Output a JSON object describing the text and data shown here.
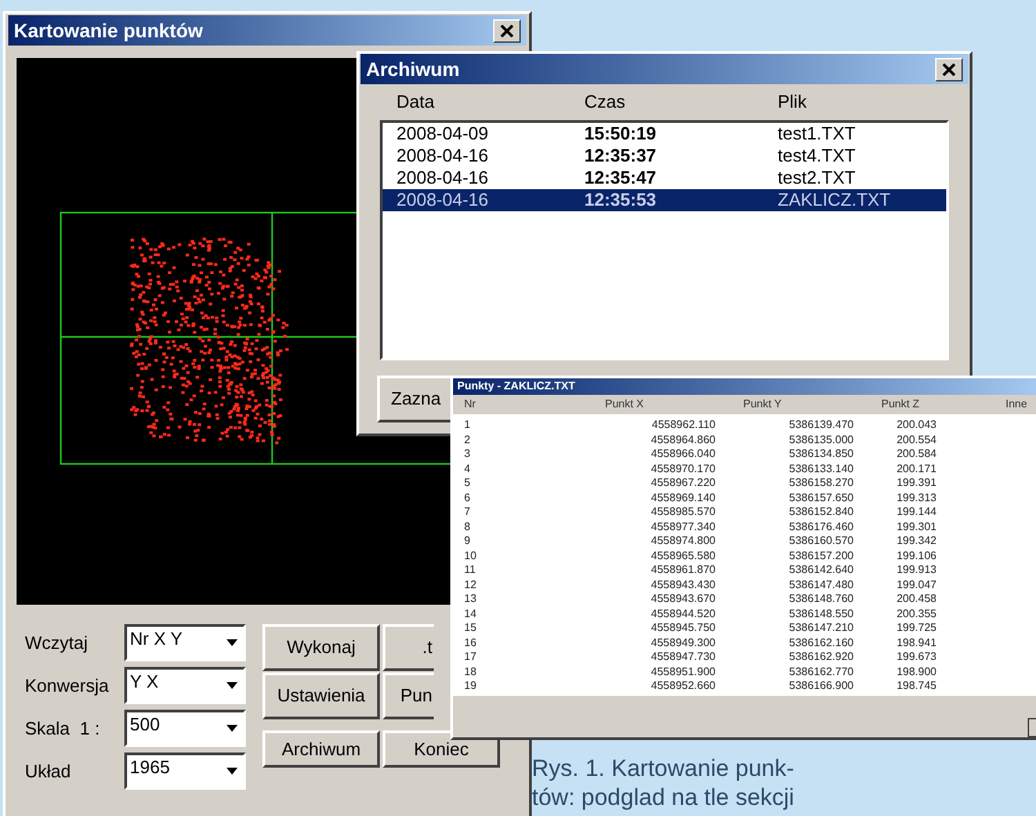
{
  "main_window": {
    "title": "Kartowanie punktów",
    "fields": [
      {
        "label": "Wczytaj",
        "value": "Nr X Y"
      },
      {
        "label": "Konwersja",
        "value": "Y X"
      },
      {
        "label": "Skala  1 :",
        "value": "500"
      },
      {
        "label": "Układ",
        "value": "1965"
      }
    ],
    "buttons": [
      {
        "label": "Wykonaj",
        "partly_hidden": false
      },
      {
        "label": ".t",
        "partly_hidden": true
      },
      {
        "label": "Ustawienia",
        "partly_hidden": false
      },
      {
        "label": "Pun",
        "partly_hidden": true
      },
      {
        "label": "Archiwum",
        "partly_hidden": false
      },
      {
        "label": "Koniec",
        "partly_hidden": false
      }
    ]
  },
  "archive_window": {
    "title": "Archiwum",
    "columns": [
      "Data",
      "Czas",
      "Plik"
    ],
    "rows": [
      {
        "cells": [
          "2008-04-09",
          "15:50:19",
          "test1.TXT"
        ],
        "selected": false
      },
      {
        "cells": [
          "2008-04-16",
          "12:35:37",
          "test4.TXT"
        ],
        "selected": false
      },
      {
        "cells": [
          "2008-04-16",
          "12:35:47",
          "test2.TXT"
        ],
        "selected": false
      },
      {
        "cells": [
          "2008-04-16",
          "12:35:53",
          "ZAKLICZ.TXT"
        ],
        "selected": true
      }
    ],
    "button": "Zazna"
  },
  "points_window": {
    "title": "Punkty - ZAKLICZ.TXT",
    "columns": [
      "Nr",
      "Punkt X",
      "Punkt Y",
      "Punkt Z",
      "Inne"
    ],
    "rows": [
      [
        "1",
        "4558962.110",
        "5386139.470",
        "200.043"
      ],
      [
        "2",
        "4558964.860",
        "5386135.000",
        "200.554"
      ],
      [
        "3",
        "4558966.040",
        "5386134.850",
        "200.584"
      ],
      [
        "4",
        "4558970.170",
        "5386133.140",
        "200.171"
      ],
      [
        "5",
        "4558967.220",
        "5386158.270",
        "199.391"
      ],
      [
        "6",
        "4558969.140",
        "5386157.650",
        "199.313"
      ],
      [
        "7",
        "4558985.570",
        "5386152.840",
        "199.144"
      ],
      [
        "8",
        "4558977.340",
        "5386176.460",
        "199.301"
      ],
      [
        "9",
        "4558974.800",
        "5386160.570",
        "199.342"
      ],
      [
        "10",
        "4558965.580",
        "5386157.200",
        "199.106"
      ],
      [
        "11",
        "4558961.870",
        "5386142.640",
        "199.913"
      ],
      [
        "12",
        "4558943.430",
        "5386147.480",
        "199.047"
      ],
      [
        "13",
        "4558943.670",
        "5386148.760",
        "200.458"
      ],
      [
        "14",
        "4558944.520",
        "5386148.550",
        "200.355"
      ],
      [
        "15",
        "4558945.750",
        "5386147.210",
        "199.725"
      ],
      [
        "16",
        "4558949.300",
        "5386162.160",
        "198.941"
      ],
      [
        "17",
        "4558947.730",
        "5386162.920",
        "199.673"
      ],
      [
        "18",
        "4558951.900",
        "5386162.770",
        "198.900"
      ],
      [
        "19",
        "4558952.660",
        "5386166.900",
        "198.745"
      ]
    ]
  },
  "caption": [
    "Rys. 1. Kartowanie punk-",
    "tów: podglad na tle sekcji"
  ]
}
